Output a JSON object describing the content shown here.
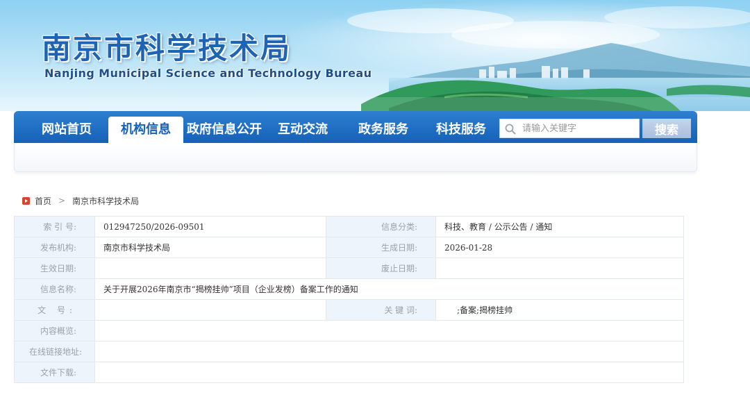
{
  "header": {
    "title": "南京市科学技术局",
    "subtitle": "Nanjing Municipal Science and Technology Bureau"
  },
  "nav": {
    "items": [
      {
        "label": "网站首页",
        "active": false
      },
      {
        "label": "机构信息",
        "active": true
      },
      {
        "label": "政府信息公开",
        "active": false
      },
      {
        "label": "互动交流",
        "active": false
      },
      {
        "label": "政务服务",
        "active": false
      },
      {
        "label": "科技服务",
        "active": false
      }
    ],
    "search": {
      "placeholder": "请输入关键字",
      "value": "",
      "icon": "search-icon"
    },
    "search_button": "搜索"
  },
  "breadcrumb": {
    "icon": "home-icon",
    "home": "首页",
    "separator": ">",
    "current": "南京市科学技术局"
  },
  "info": {
    "index_label": "索 引 号:",
    "index_value": "012947250/2026-09501",
    "category_label": "信息分类:",
    "category_value": "科技、教育 / 公示公告 / 通知",
    "publisher_label": "发布机构:",
    "publisher_value": "南京市科学技术局",
    "created_label": "生成日期:",
    "created_value": "2026-01-28",
    "effective_label": "生效日期:",
    "effective_value": "",
    "expiry_label": "废止日期:",
    "expiry_value": "",
    "name_label": "信息名称:",
    "name_value": "关于开展2026年南京市“揭榜挂帅”项目（企业发榜）备案工作的通知",
    "docno_label": "文 号:",
    "docno_value": "",
    "keywords_label": "关 键 词:",
    "keywords_value": ";备案;揭榜挂帅",
    "summary_label": "内容概览:",
    "summary_value": "",
    "link_label": "在线链接地址:",
    "link_value": "",
    "download_label": "文件下载:",
    "download_value": ""
  },
  "colors": {
    "nav_blue": "#1561b8",
    "title_blue": "#1f63b4",
    "label_bg": "#eef4fb",
    "border": "#e3e8ef",
    "home_icon_red": "#d9452b"
  }
}
